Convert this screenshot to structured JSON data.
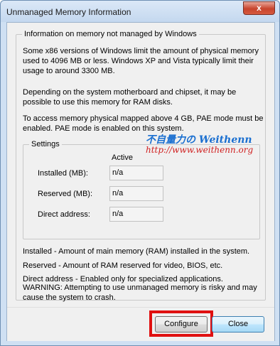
{
  "window": {
    "title": "Unmanaged Memory Information",
    "close_glyph": "x"
  },
  "info": {
    "legend": "Information on memory not managed by Windows",
    "para1": [
      "Some x86 versions of Windows limit the amount of physical memory",
      "used to 4096 MB or less. Windows XP and Vista typically limit their",
      "usage to around 3300 MB."
    ],
    "para2": [
      "Depending on the system motherboard and chipset, it may be",
      "possible to use this memory for RAM disks."
    ],
    "para3": [
      "To access memory physical mapped above 4 GB, PAE mode must be",
      "enabled. PAE mode is enabled on this system."
    ],
    "settings": {
      "legend": "Settings",
      "column_header": "Active",
      "rows": [
        {
          "label": "Installed (MB):",
          "value": "n/a"
        },
        {
          "label": "Reserved (MB):",
          "value": "n/a"
        },
        {
          "label": "Direct address:",
          "value": "n/a"
        }
      ]
    },
    "notes": [
      "Installed - Amount of main memory (RAM) installed in the system.",
      "Reserved - Amount of RAM reserved for video, BIOS, etc.",
      "Direct address - Enabled only for specialized applications."
    ],
    "warning": [
      "WARNING: Attempting to use unmanaged memory is risky and may",
      "cause the system to crash."
    ]
  },
  "watermark": {
    "line1": "不自量力の Weithenn",
    "line2": "http://www.weithenn.org"
  },
  "buttons": {
    "configure": "Configure",
    "close": "Close"
  },
  "colors": {
    "highlight": "#e01010",
    "watermark_blue": "#1a6fd0",
    "watermark_red": "#d02020"
  }
}
